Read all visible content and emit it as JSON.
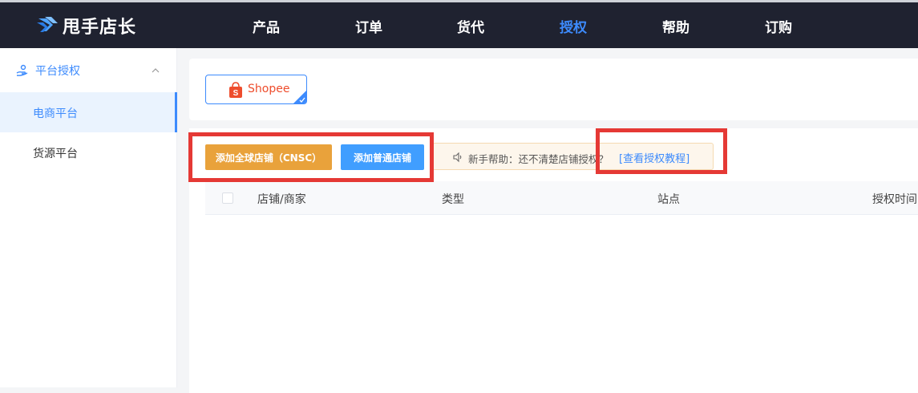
{
  "header": {
    "brand": "甩手店长",
    "nav": [
      {
        "label": "产品",
        "active": false
      },
      {
        "label": "订单",
        "active": false
      },
      {
        "label": "货代",
        "active": false
      },
      {
        "label": "授权",
        "active": true
      },
      {
        "label": "帮助",
        "active": false
      },
      {
        "label": "订购",
        "active": false
      }
    ]
  },
  "sidebar": {
    "group_label": "平台授权",
    "group_icon": "hand-icon",
    "items": [
      {
        "label": "电商平台",
        "active": true
      },
      {
        "label": "货源平台",
        "active": false
      }
    ]
  },
  "platforms": {
    "selected": "Shopee"
  },
  "actions": {
    "add_global_shop": "添加全球店铺（CNSC）",
    "add_normal_shop": "添加普通店铺"
  },
  "help": {
    "text": "新手帮助：还不清楚店铺授权？",
    "link": "[查看授权教程]"
  },
  "table": {
    "columns": [
      "店铺/商家",
      "类型",
      "站点",
      "授权时间"
    ]
  },
  "colors": {
    "accent": "#3d8bfd",
    "topbar": "#1f2230",
    "orange_button": "#e9a23b",
    "blue_button": "#409eff",
    "shopee": "#ee4d2d",
    "highlight": "#e53935"
  }
}
